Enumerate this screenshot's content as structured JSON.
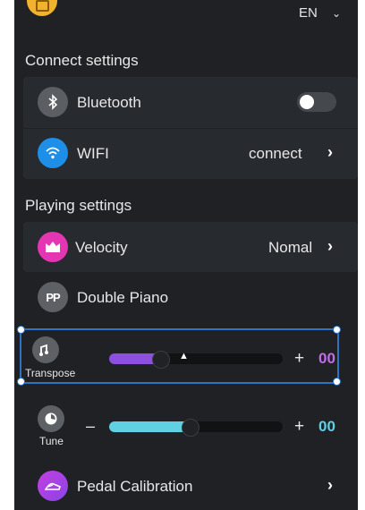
{
  "header": {
    "language": "EN",
    "language_chevron_icon": "chevron-down-icon",
    "app_icon": "app-logo-icon"
  },
  "connect": {
    "title": "Connect settings",
    "bluetooth": {
      "label": "Bluetooth",
      "icon": "bluetooth-icon",
      "enabled": false
    },
    "wifi": {
      "label": "WIFI",
      "icon": "wifi-icon",
      "status": "connect"
    }
  },
  "playing": {
    "title": "Playing settings",
    "velocity": {
      "label": "Velocity",
      "icon": "velocity-icon",
      "value": "Nomal"
    },
    "double_piano": {
      "label": "Double Piano",
      "icon": "double-piano-icon"
    },
    "transpose": {
      "label": "Transpose",
      "icon": "transpose-icon",
      "plus": "+",
      "value": "00",
      "level": 0.3
    },
    "tune": {
      "label": "Tune",
      "icon": "tune-icon",
      "minus": "–",
      "plus": "+",
      "value": "00",
      "level": 0.47
    },
    "pedal": {
      "label": "Pedal Calibration",
      "icon": "pedal-icon"
    }
  },
  "colors": {
    "background": "#1f2125",
    "card": "#272a2f",
    "transpose_accent": "#8c4fe0",
    "tune_accent": "#5fd1e3",
    "selection": "#2d73c5",
    "app_icon": "#f2b22d"
  }
}
